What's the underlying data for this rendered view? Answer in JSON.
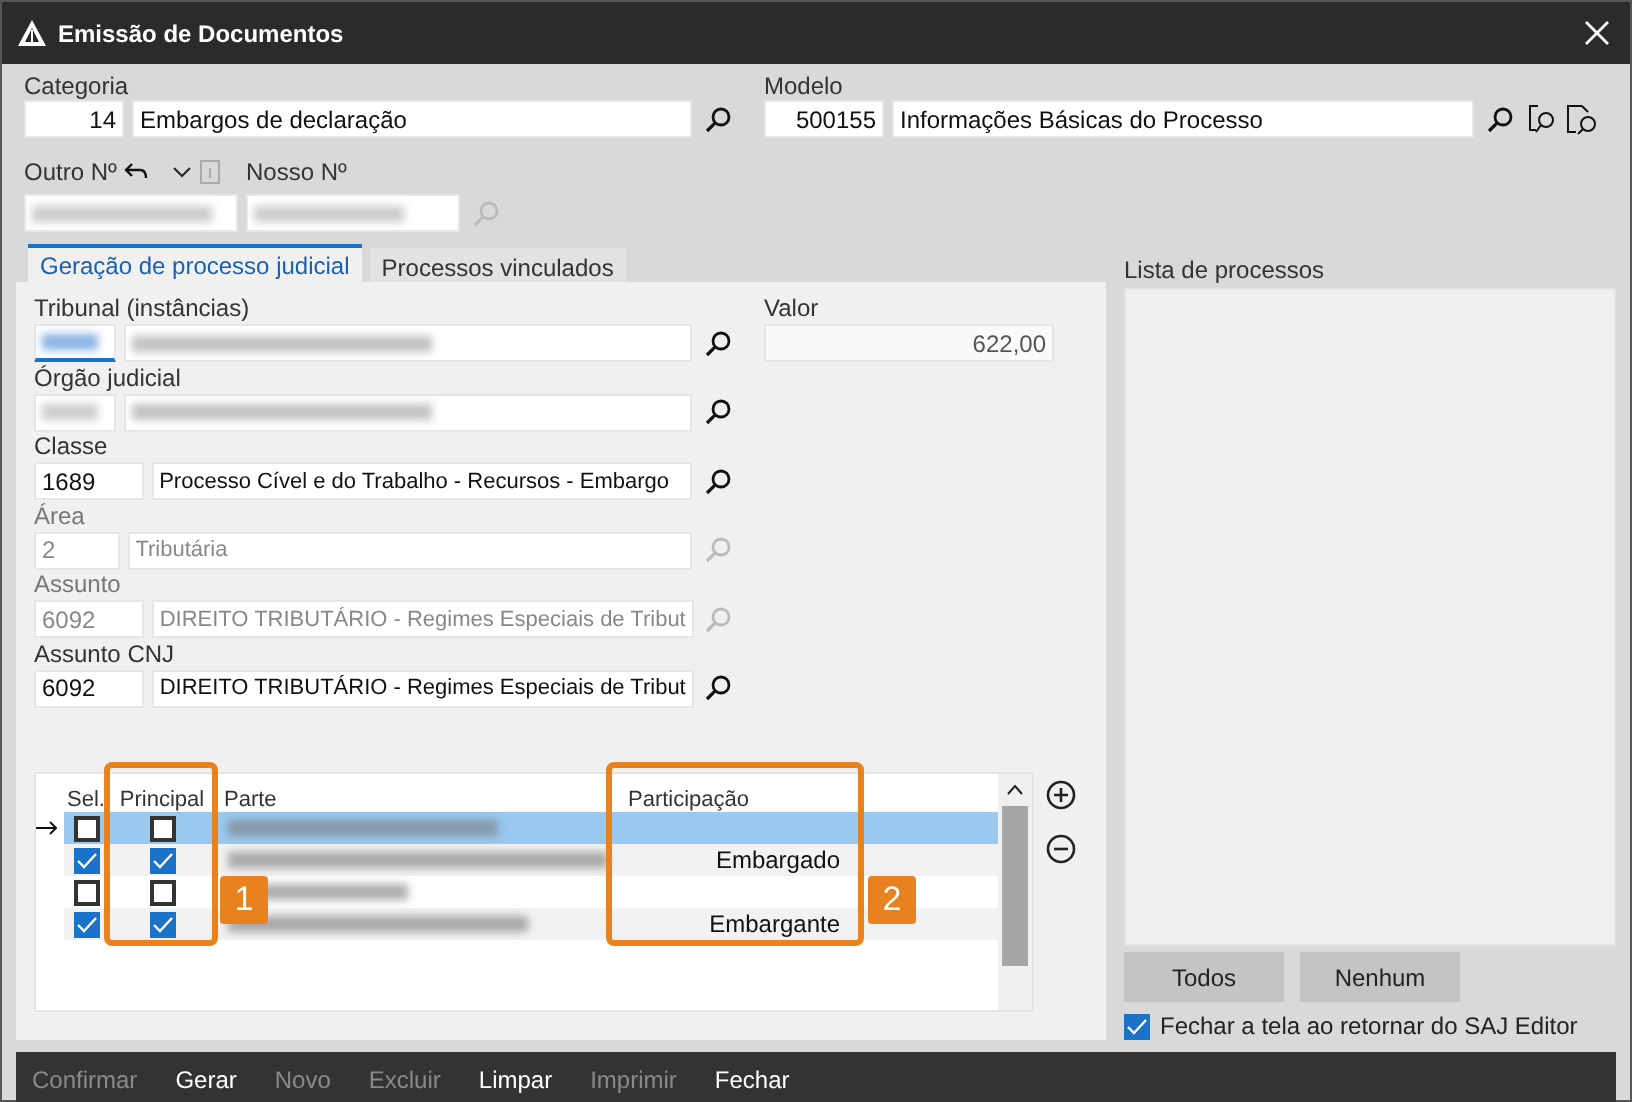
{
  "window": {
    "title": "Emissão de Documentos"
  },
  "categoria": {
    "label": "Categoria",
    "code": "14",
    "name": "Embargos de declaração"
  },
  "modelo": {
    "label": "Modelo",
    "code": "500155",
    "name": "Informações Básicas do Processo"
  },
  "outro_numero": {
    "label": "Outro Nº"
  },
  "nosso_numero": {
    "label": "Nosso Nº"
  },
  "tabs": [
    {
      "label": "Geração de processo judicial",
      "selected": true
    },
    {
      "label": "Processos vinculados",
      "selected": false
    }
  ],
  "fields": [
    {
      "label": "Tribunal (instâncias)",
      "blurred": true,
      "focused": true,
      "disabled": false
    },
    {
      "label": "Órgão judicial",
      "blurred": true,
      "focused": false,
      "disabled": false
    },
    {
      "label": "Classe",
      "code": "1689",
      "name": "Processo Cível e do Trabalho - Recursos - Embargo",
      "blurred": false,
      "focused": false,
      "disabled": false
    },
    {
      "label": "Área",
      "code": "2",
      "name": "Tributária",
      "blurred": false,
      "focused": false,
      "disabled": true
    },
    {
      "label": "Assunto",
      "code": "6092",
      "name": "DIREITO TRIBUTÁRIO - Regimes Especiais de Tribut",
      "blurred": false,
      "focused": false,
      "disabled": true
    },
    {
      "label": "Assunto CNJ",
      "code": "6092",
      "name": "DIREITO TRIBUTÁRIO - Regimes Especiais de Tribut",
      "blurred": false,
      "focused": false,
      "disabled": false
    }
  ],
  "valor": {
    "label": "Valor",
    "value": "622,00"
  },
  "grid": {
    "columns": [
      "Sel.",
      "Principal",
      "Parte",
      "Participação"
    ],
    "rows": [
      {
        "current": true,
        "selected": true,
        "sel": false,
        "principal": false
      },
      {
        "current": false,
        "selected": false,
        "sel": true,
        "principal": true,
        "participacao": "Embargado"
      },
      {
        "current": false,
        "selected": false,
        "sel": false,
        "principal": false
      },
      {
        "current": false,
        "selected": false,
        "sel": true,
        "principal": true,
        "participacao": "Embargante"
      }
    ]
  },
  "annotations": [
    {
      "label": "1"
    },
    {
      "label": "2"
    }
  ],
  "lista": {
    "label": "Lista de processos"
  },
  "lista_buttons": [
    "Todos",
    "Nenhum"
  ],
  "close_option": {
    "label": "Fechar a tela ao retornar do SAJ Editor",
    "checked": true
  },
  "toolbar": [
    {
      "label": "Confirmar",
      "disabled": true
    },
    {
      "label": "Gerar",
      "disabled": false
    },
    {
      "label": "Novo",
      "disabled": true
    },
    {
      "label": "Excluir",
      "disabled": true
    },
    {
      "label": "Limpar",
      "disabled": false
    },
    {
      "label": "Imprimir",
      "disabled": true
    },
    {
      "label": "Fechar",
      "disabled": false
    }
  ]
}
